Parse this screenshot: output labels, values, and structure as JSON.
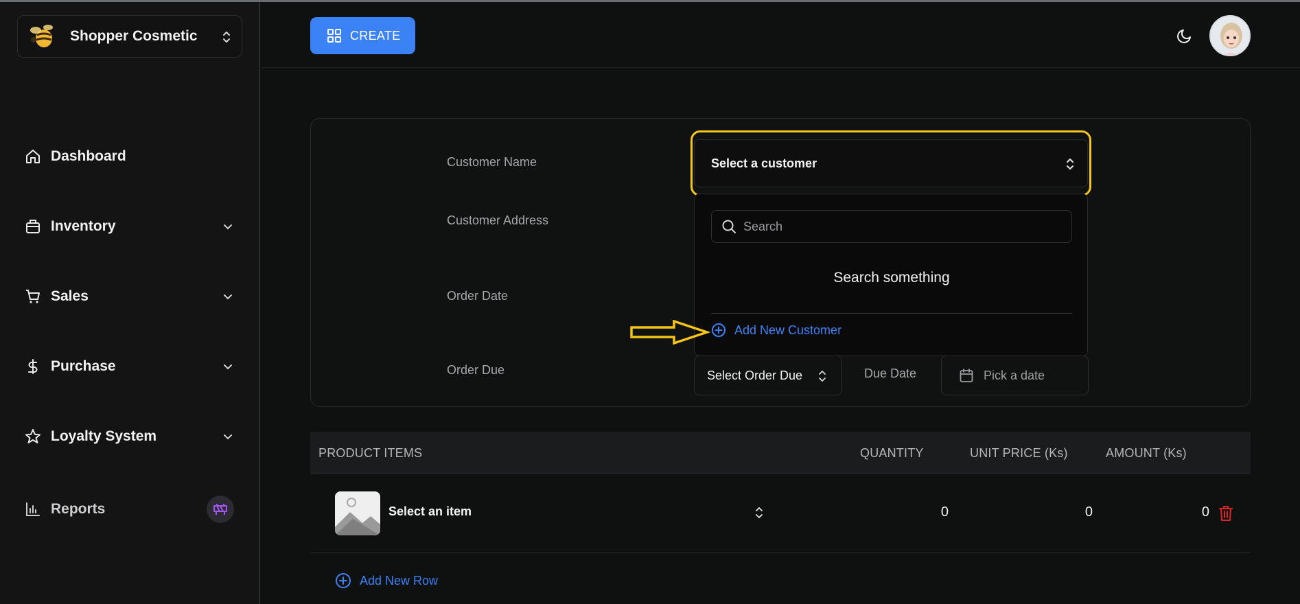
{
  "store": {
    "name": "Shopper Cosmetic",
    "logo_icon": "bee-logo-icon"
  },
  "sidebar": {
    "items": [
      {
        "label": "Dashboard",
        "icon": "home-icon"
      },
      {
        "label": "Inventory",
        "icon": "package-icon",
        "expandable": true
      },
      {
        "label": "Sales",
        "icon": "cart-icon",
        "expandable": true
      },
      {
        "label": "Purchase",
        "icon": "dollar-icon",
        "expandable": true
      },
      {
        "label": "Loyalty System",
        "icon": "star-icon",
        "expandable": true
      },
      {
        "label": "Reports",
        "icon": "bar-chart-icon",
        "badge_icon": "construction-icon"
      }
    ]
  },
  "header": {
    "create_label": "CREATE",
    "theme_icon": "moon-icon"
  },
  "form": {
    "customer_name_label": "Customer Name",
    "customer_address_label": "Customer Address",
    "order_date_label": "Order Date",
    "order_due_label": "Order Due",
    "customer_select_placeholder": "Select a customer",
    "dropdown": {
      "search_placeholder": "Search",
      "empty_text": "Search something",
      "add_customer_label": "Add New Customer"
    },
    "order_due_select": "Select Order Due",
    "due_date_label": "Due Date",
    "date_picker_placeholder": "Pick a date"
  },
  "table": {
    "headers": [
      "PRODUCT ITEMS",
      "QUANTITY",
      "UNIT PRICE (Ks)",
      "AMOUNT (Ks)"
    ],
    "rows": [
      {
        "item": "Select an item",
        "quantity": "0",
        "unit_price": "0",
        "amount": "0"
      }
    ],
    "add_row_label": "Add New Row"
  },
  "colors": {
    "accent": "#3b82f6",
    "highlight": "#f5c518",
    "danger": "#dc2626",
    "badge": "#a855f7"
  }
}
